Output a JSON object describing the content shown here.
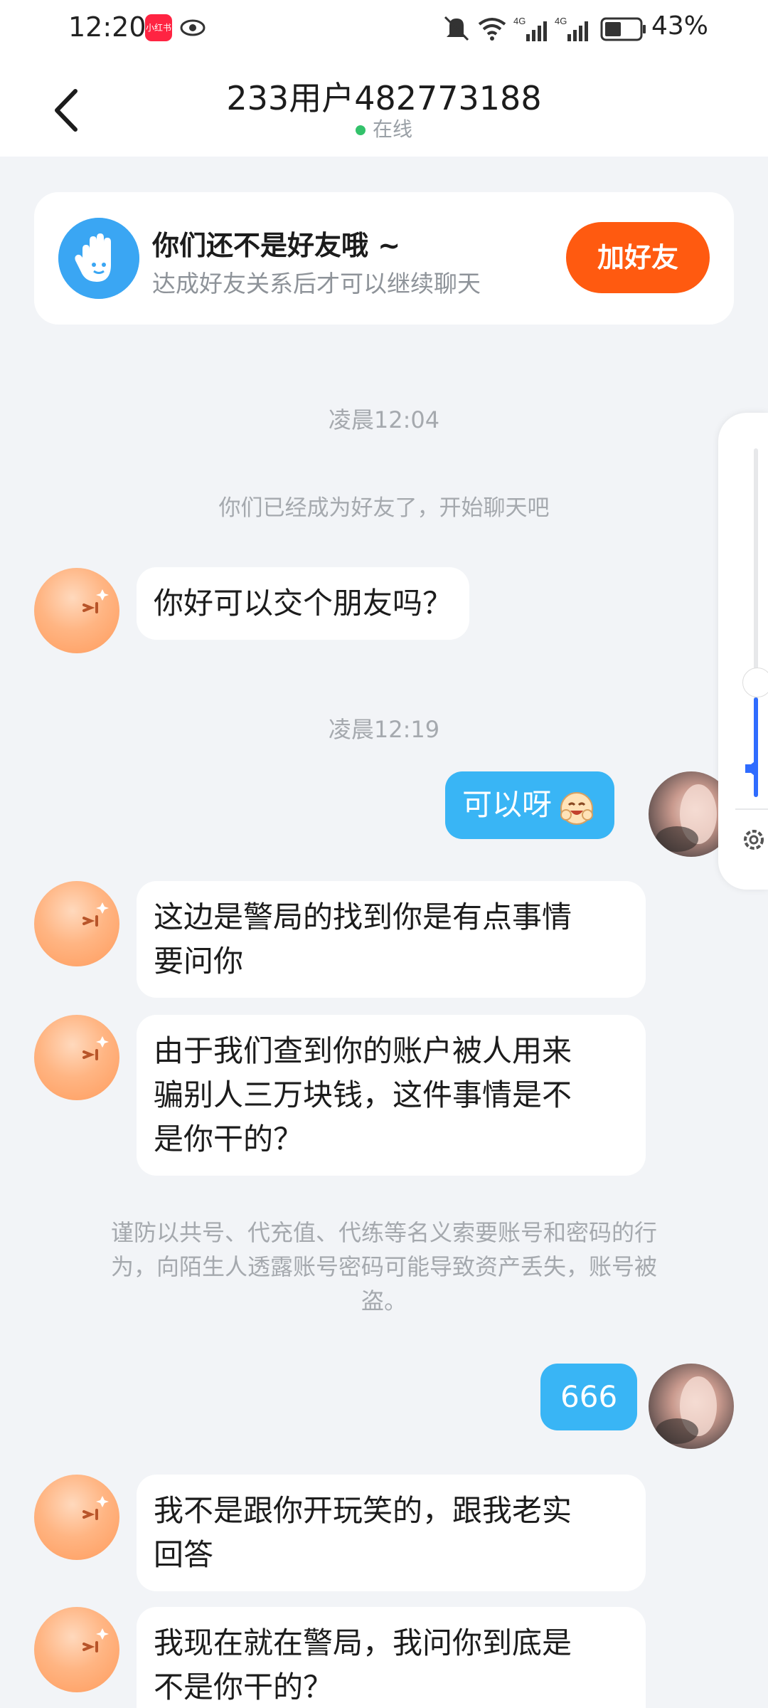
{
  "status_bar": {
    "time": "12:20",
    "app_icon_text": "小红书",
    "battery": "43%",
    "icons": [
      "eye-icon",
      "mute-icon",
      "wifi-icon",
      "signal-4g-icon",
      "signal-4g-icon",
      "battery-icon"
    ]
  },
  "header": {
    "title": "233用户482773188",
    "status": "在线",
    "status_color": "#33c26b"
  },
  "friend_card": {
    "title": "你们还不是好友哦 ~",
    "subtitle": "达成好友关系后才可以继续聊天",
    "button_label": "加好友",
    "button_color": "#ff5a10"
  },
  "messages": [
    {
      "type": "time",
      "text": "凌晨12:04"
    },
    {
      "type": "system",
      "text": "你们已经成为好友了，开始聊天吧"
    },
    {
      "type": "incoming",
      "text": "你好可以交个朋友吗？"
    },
    {
      "type": "time",
      "text": "凌晨12:19"
    },
    {
      "type": "outgoing",
      "text": "可以呀",
      "emoji": "laughing-emoji"
    },
    {
      "type": "incoming",
      "lines": [
        "这边是警局的找到你是有点事情",
        "要问你"
      ]
    },
    {
      "type": "incoming",
      "lines": [
        "由于我们查到你的账户被人用来",
        "骗别人三万块钱，这件事情是不",
        "是你干的？"
      ]
    },
    {
      "type": "warning",
      "lines": [
        "谨防以共号、代充值、代练等名义索要账号和密码的行",
        "为，向陌生人透露账号密码可能导致资产丢失，账号被",
        "盗。"
      ]
    },
    {
      "type": "outgoing",
      "text": "666"
    },
    {
      "type": "incoming",
      "lines": [
        "我不是跟你开玩笑的，跟我老实",
        "回答"
      ]
    },
    {
      "type": "incoming",
      "lines": [
        "我现在就在警局，我问你到底是",
        "不是你干的？"
      ]
    }
  ],
  "colors": {
    "outgoing_bubble": "#39b5f5",
    "background": "#f2f4f7"
  },
  "volume_panel": {
    "level": 0.28,
    "icons": [
      "speaker-icon",
      "settings-gear-icon"
    ]
  }
}
